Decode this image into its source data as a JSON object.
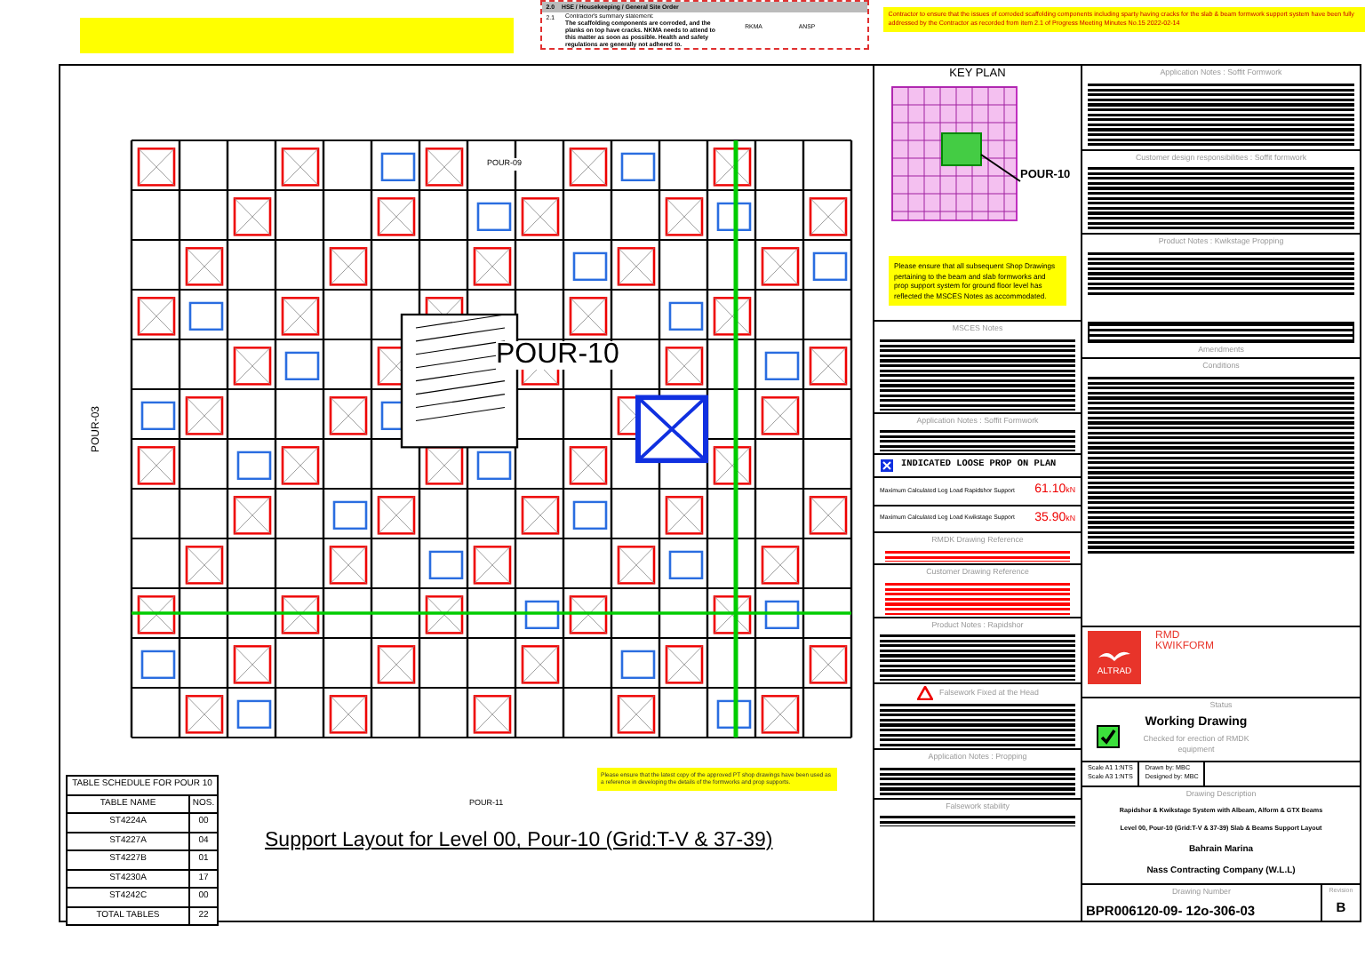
{
  "review_table": {
    "section_no": "2.0",
    "section_title": "HSE / Housekeeping / General Site Order",
    "item_no": "2.1",
    "item_heading": "Contractor's summary statement:",
    "item_text": "The scaffolding components are corroded, and the planks on top have cracks. NKMA needs to attend to this matter as soon as possible. Health and safety regulations are generally not adhered to.",
    "column_3": "RKMA",
    "column_4": "ANSP"
  },
  "review_comment": "Contractor to ensure that the issues of corroded scaffolding components including sparty having cracks for the slab & beam formwork support system have been fully addressed by the Contractor as recorded from item 2.1 of Progress Meeting Minutes No.15 2022-02-14",
  "drawing": {
    "labels": [
      {
        "kind": "pour",
        "text": "POUR-09"
      },
      {
        "kind": "big",
        "text": "POUR-10"
      },
      {
        "kind": "pour",
        "text": "POUR-11"
      },
      {
        "kind": "vertical",
        "text": "POUR-03"
      }
    ],
    "title": "Support Layout for Level 00, Pour-10 (Grid:T-V & 37-39)",
    "note": "Please ensure that the latest copy of the approved PT shop drawings have been used as a reference in developing the details of the formworks and prop supports."
  },
  "table_schedule": {
    "title": "TABLE SCHEDULE FOR POUR 10",
    "columns": [
      "TABLE NAME",
      "NOS."
    ],
    "rows": [
      [
        "ST4224A",
        "00"
      ],
      [
        "ST4227A",
        "04"
      ],
      [
        "ST4227B",
        "01"
      ],
      [
        "ST4230A",
        "17"
      ],
      [
        "ST4242C",
        "00"
      ]
    ],
    "total": [
      "TOTAL TABLES",
      "22"
    ]
  },
  "key_plan": {
    "title": "KEY PLAN",
    "label": "POUR-10"
  },
  "msces_note": "Please ensure that all subsequent Shop Drawings pertaining to the beam and slab formworks and prop support system for ground floor level has reflected the MSCES Notes as accommodated.",
  "middle_sections": [
    {
      "kind": "notes",
      "heading": "MSCES Notes"
    },
    {
      "kind": "notes",
      "heading": "Application Notes : Soffit Formwork"
    },
    {
      "kind": "legend",
      "text": "INDICATED LOOSE PROP ON PLAN"
    },
    {
      "kind": "load",
      "label": "Maximum Calculated Leg Load Rapidshor Support",
      "value": "61.10",
      "unit": "kN"
    },
    {
      "kind": "load",
      "label": "Maximum Calculated Leg Load Kwikstage Support",
      "value": "35.90",
      "unit": "kN"
    },
    {
      "kind": "refs",
      "heading": "RMDK Drawing Reference"
    },
    {
      "kind": "refs",
      "heading": "Customer Drawing Reference"
    },
    {
      "kind": "notes",
      "heading": "Product Notes : Rapidshor"
    },
    {
      "kind": "warning",
      "heading": "Falsework Fixed at the Head"
    },
    {
      "kind": "notes",
      "heading": "Application Notes : Propping"
    },
    {
      "kind": "notes",
      "heading": "Falsework stability"
    }
  ],
  "right_sections": [
    {
      "kind": "notes",
      "heading": "Application Notes : Soffit Formwork"
    },
    {
      "kind": "notes",
      "heading": "Customer design responsibilities : Soffit formwork"
    },
    {
      "kind": "notes",
      "heading": "Product Notes : Kwikstage Propping"
    },
    {
      "kind": "amendments",
      "heading": "Amendments"
    },
    {
      "kind": "notes",
      "heading": "Conditions"
    }
  ],
  "title_block": {
    "logo": {
      "brand": "ALTRAD",
      "name_1": "RMD",
      "name_2": "KWIKFORM"
    },
    "status_heading": "Status",
    "status": "Working Drawing",
    "status_note": "Checked for erection of RMDK equipment",
    "approved": true,
    "scales": [
      "Scale A1 1:NTS",
      "Scale A3 1:NTS"
    ],
    "people": [
      "Drawn by: MBC",
      "Designed by: MBC"
    ],
    "description_heading": "Drawing Description",
    "description": [
      "Rapidshor & Kwikstage System with Albeam, Alform & GTX Beams",
      "Level 00, Pour-10 (Grid:T-V & 37-39) Slab & Beams Support Layout",
      "Bahrain Marina",
      "Nass Contracting Company (W.L.L)"
    ],
    "number_heading": "Drawing Number",
    "revision_heading": "Revision",
    "number": "BPR006120-09- 12o-306-03",
    "revision": "B"
  }
}
